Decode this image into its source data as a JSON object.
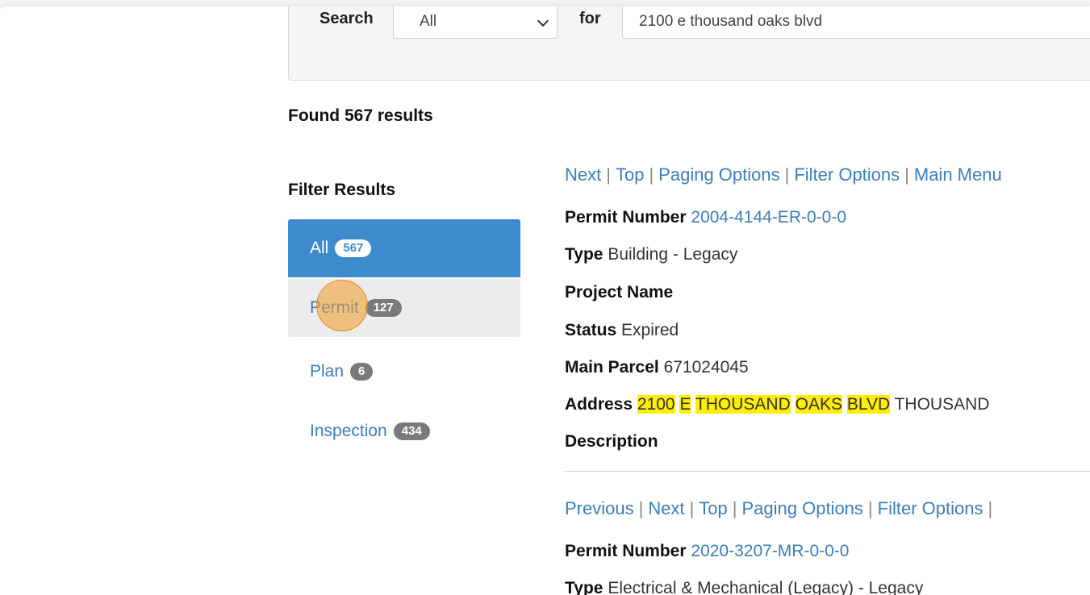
{
  "search": {
    "label": "Search",
    "select_value": "All",
    "for_label": "for",
    "query": "2100 e thousand oaks blvd"
  },
  "results": {
    "found_text": "Found 567 results"
  },
  "filter": {
    "title": "Filter Results",
    "items": [
      {
        "label": "All",
        "count": "567"
      },
      {
        "label": "Permit",
        "count": "127"
      },
      {
        "label": "Plan",
        "count": "6"
      },
      {
        "label": "Inspection",
        "count": "434"
      }
    ]
  },
  "nav1": [
    "Next",
    "Top",
    "Paging Options",
    "Filter Options",
    "Main Menu"
  ],
  "record1": {
    "permit_label": "Permit Number",
    "permit_value": "2004-4144-ER-0-0-0",
    "type_label": "Type",
    "type_value": "Building - Legacy",
    "project_label": "Project Name",
    "status_label": "Status",
    "status_value": "Expired",
    "parcel_label": "Main Parcel",
    "parcel_value": "671024045",
    "address_label": "Address",
    "address_parts": [
      "2100",
      "E",
      "THOUSAND",
      "OAKS",
      "BLVD"
    ],
    "address_rest": "THOUSAND",
    "description_label": "Description"
  },
  "nav2": [
    "Previous",
    "Next",
    "Top",
    "Paging Options",
    "Filter Options"
  ],
  "record2": {
    "permit_label": "Permit Number",
    "permit_value": "2020-3207-MR-0-0-0",
    "type_label": "Type",
    "type_value": "Electrical & Mechanical (Legacy) - Legacy"
  },
  "colors": {
    "accent": "#3d8bcd",
    "link": "#3a7dbf",
    "highlight": "#ffee00",
    "cursor": "#f39c28"
  }
}
